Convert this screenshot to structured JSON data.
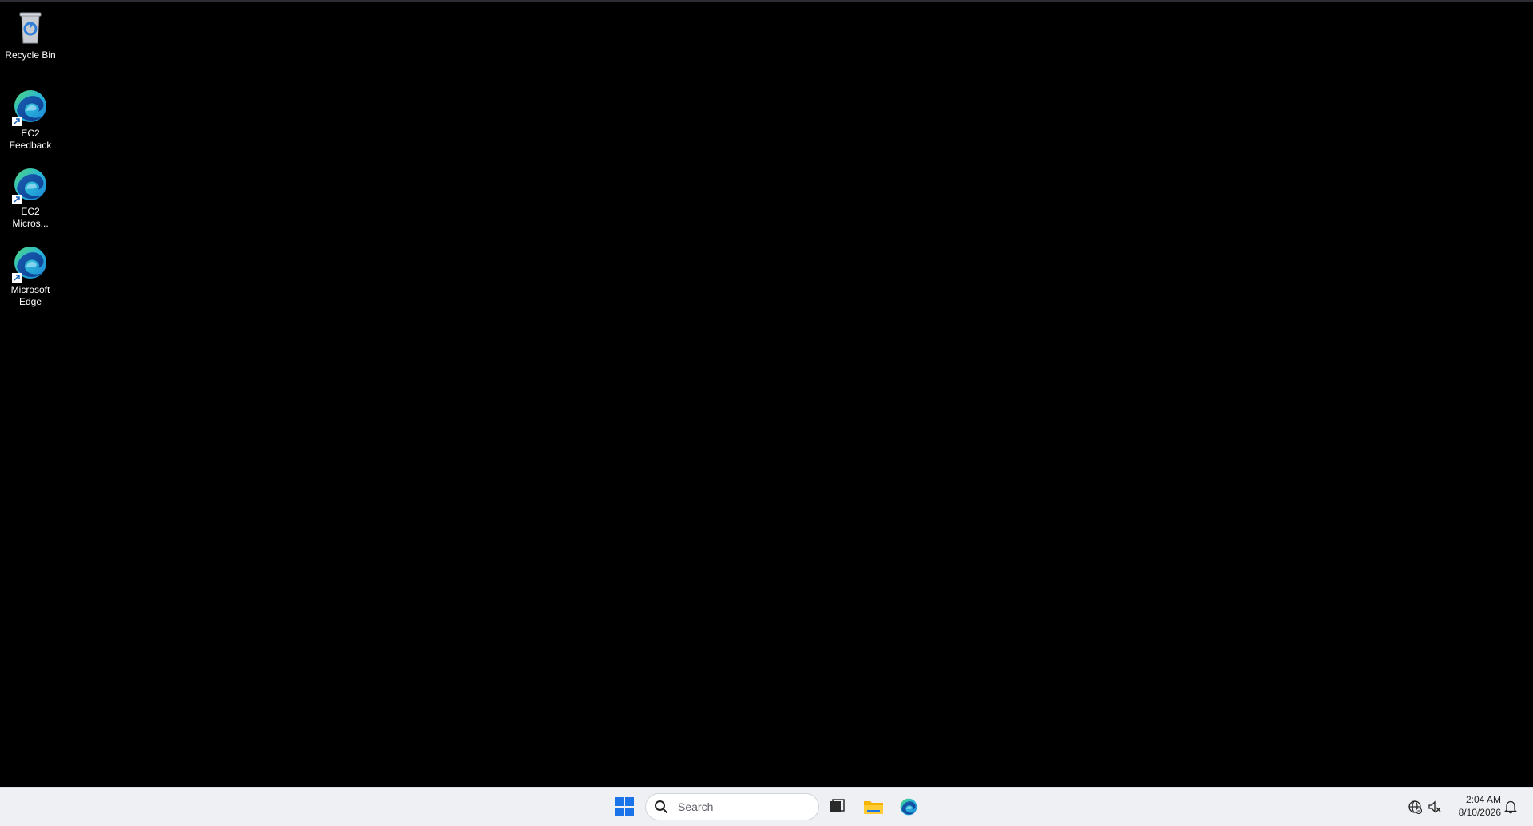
{
  "desktop": {
    "icons": [
      {
        "label": "Recycle Bin",
        "icon": "recycle-bin-icon"
      },
      {
        "label": "EC2\nFeedback",
        "icon": "edge-shortcut-icon"
      },
      {
        "label": "EC2\nMicros...",
        "icon": "edge-shortcut-icon"
      },
      {
        "label": "Microsoft\nEdge",
        "icon": "edge-shortcut-icon"
      }
    ]
  },
  "taskbar": {
    "search_placeholder": "Search",
    "pinned": [
      {
        "name": "start",
        "icon": "windows-start-icon"
      },
      {
        "name": "task-view",
        "icon": "task-view-icon"
      },
      {
        "name": "file-explorer",
        "icon": "folder-icon"
      },
      {
        "name": "edge",
        "icon": "edge-icon"
      }
    ],
    "tray": [
      {
        "name": "network",
        "icon": "globe-icon"
      },
      {
        "name": "volume",
        "icon": "speaker-muted-icon"
      }
    ],
    "clock": {
      "time": "2:04 AM",
      "date": "8/10/2026"
    }
  },
  "colors": {
    "desktop_bg": "#000000",
    "taskbar_bg": "#eef0f4",
    "start_blue": "#1a73e8"
  }
}
